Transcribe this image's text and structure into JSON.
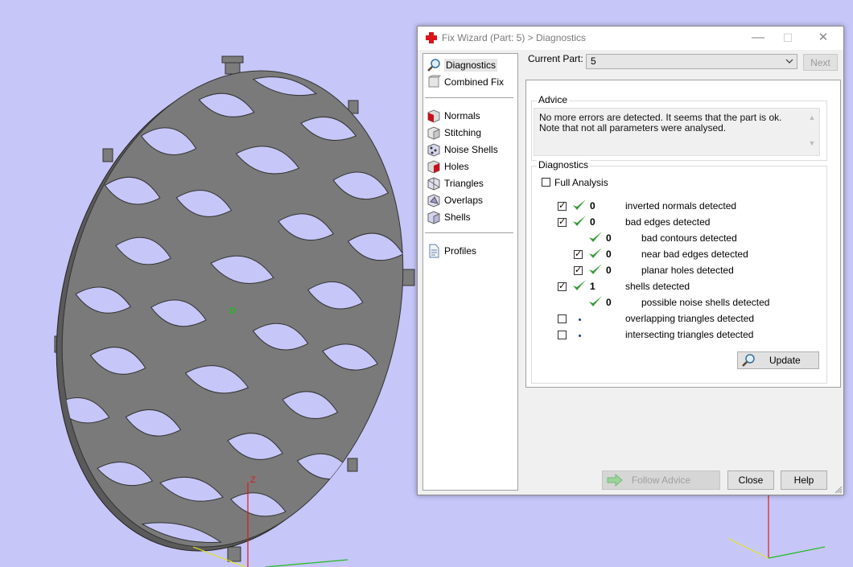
{
  "window": {
    "title": "Fix Wizard (Part: 5) > Diagnostics",
    "minimize": "—",
    "maximize": "☐",
    "close": "✕"
  },
  "nav": {
    "items": [
      {
        "label": "Diagnostics",
        "icon": "magnifier-icon",
        "selected": true
      },
      {
        "label": "Combined Fix",
        "icon": "combined-fix-icon"
      },
      {
        "label": "Normals",
        "icon": "normals-cube-icon"
      },
      {
        "label": "Stitching",
        "icon": "stitching-cube-icon"
      },
      {
        "label": "Noise Shells",
        "icon": "noise-shells-icon"
      },
      {
        "label": "Holes",
        "icon": "holes-cube-icon"
      },
      {
        "label": "Triangles",
        "icon": "triangles-cube-icon"
      },
      {
        "label": "Overlaps",
        "icon": "overlaps-cube-icon"
      },
      {
        "label": "Shells",
        "icon": "shells-cube-icon"
      },
      {
        "label": "Profiles",
        "icon": "document-icon"
      }
    ]
  },
  "current_part": {
    "label": "Current Part:",
    "value": "5",
    "next_label": "Next"
  },
  "advice": {
    "title": "Advice",
    "text": "No more errors are detected. It seems that the part is ok. Note that not all parameters were analysed."
  },
  "diagnostics": {
    "title": "Diagnostics",
    "full_analysis_label": "Full Analysis",
    "rows": [
      {
        "checkbox": true,
        "checked": true,
        "status": "ok",
        "count": "0",
        "label": "inverted normals detected",
        "indent": false
      },
      {
        "checkbox": true,
        "checked": true,
        "status": "ok",
        "count": "0",
        "label": "bad edges detected",
        "indent": false
      },
      {
        "checkbox": false,
        "checked": false,
        "status": "ok",
        "count": "0",
        "label": "bad contours detected",
        "indent": true
      },
      {
        "checkbox": true,
        "checked": true,
        "status": "ok",
        "count": "0",
        "label": "near bad edges detected",
        "indent": true
      },
      {
        "checkbox": true,
        "checked": true,
        "status": "ok",
        "count": "0",
        "label": "planar holes detected",
        "indent": true
      },
      {
        "checkbox": true,
        "checked": true,
        "status": "ok",
        "count": "1",
        "label": "shells detected",
        "indent": false
      },
      {
        "checkbox": false,
        "checked": false,
        "status": "ok",
        "count": "0",
        "label": "possible noise shells detected",
        "indent": true
      },
      {
        "checkbox": true,
        "checked": false,
        "status": "dot",
        "count": "",
        "label": "overlapping triangles detected",
        "indent": false
      },
      {
        "checkbox": true,
        "checked": false,
        "status": "dot",
        "count": "",
        "label": "intersecting triangles detected",
        "indent": false
      }
    ],
    "update_label": "Update"
  },
  "buttons": {
    "follow_advice": "Follow Advice",
    "close": "Close",
    "help": "Help"
  },
  "viewport": {
    "part_color": "#7a7a7a",
    "background_color": "#c6c6f8",
    "axis_label": "Z"
  }
}
